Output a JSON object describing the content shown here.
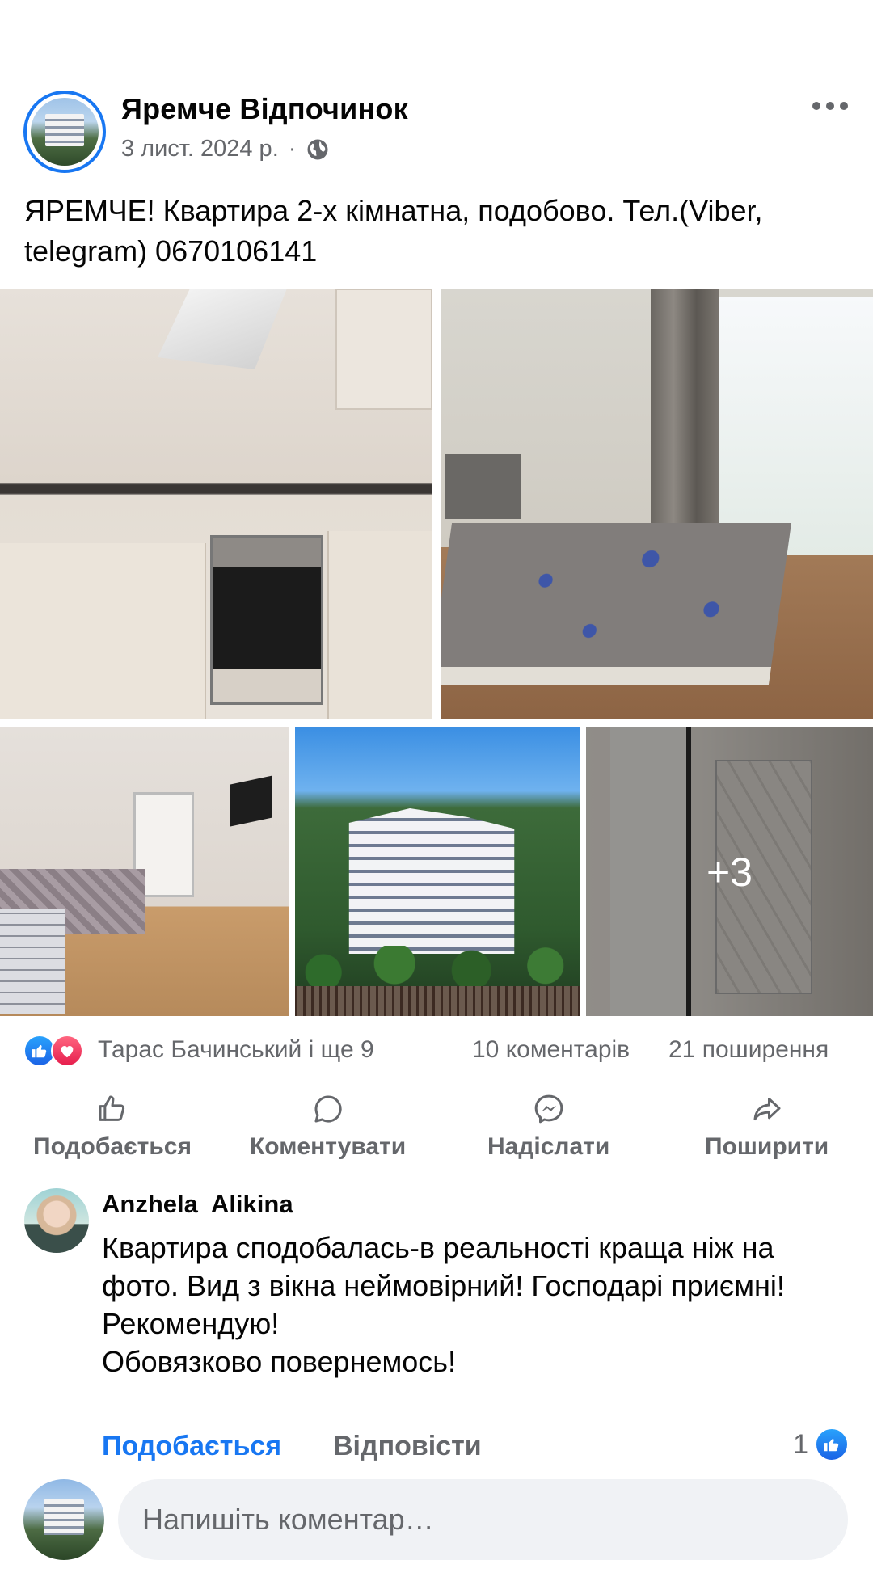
{
  "post": {
    "page_name": "Яремче Відпочинок",
    "date": "3 лист. 2024 р.",
    "separator": "·",
    "audience_icon": "globe-icon",
    "text": "ЯРЕМЧЕ! Квартира 2-х кімнатна, подобово. Тел.(Viber, telegram) 0670106141",
    "more_photos": "+3"
  },
  "stats": {
    "reactors": "Тарас Бачинський і ще 9",
    "comments": "10 коментарів",
    "shares": "21 поширення"
  },
  "actions": {
    "like": "Подобається",
    "comment": "Коментувати",
    "send": "Надіслати",
    "share": "Поширити"
  },
  "comment": {
    "author": "Anzhela  Alikina",
    "text": "Квартира сподобалась-в реальності краща ніж на фото. Вид з вікна неймовірний! Господарі приємні!\nРекомендую!\nОбовязково повернемось!",
    "like_label": "Подобається",
    "reply_label": "Відповісти",
    "like_count": "1"
  },
  "composer": {
    "placeholder": "Напишіть коментар…"
  },
  "colors": {
    "accent": "#1877f2",
    "secondary_text": "#65676b",
    "input_bg": "#f0f2f5"
  }
}
